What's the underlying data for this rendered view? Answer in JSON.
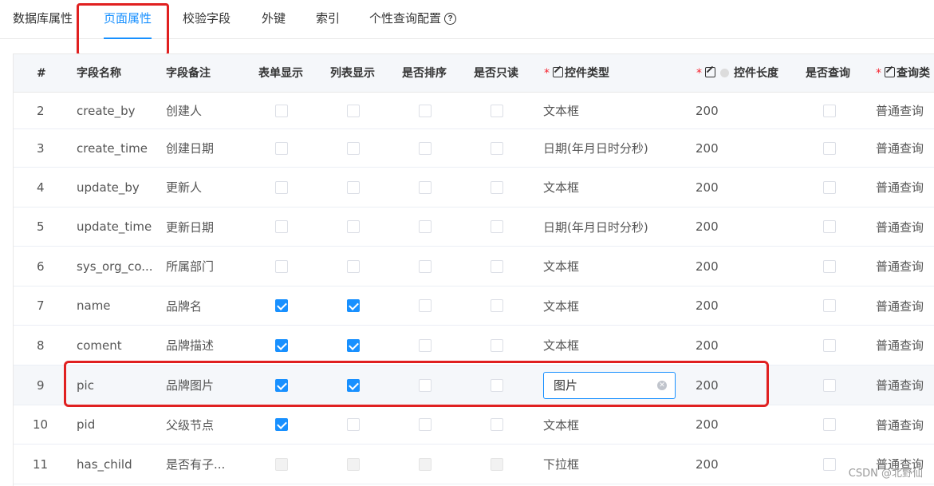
{
  "tabs": [
    {
      "label": "数据库属性"
    },
    {
      "label": "页面属性"
    },
    {
      "label": "校验字段"
    },
    {
      "label": "外键"
    },
    {
      "label": "索引"
    },
    {
      "label": "个性查询配置"
    }
  ],
  "active_tab": "页面属性",
  "header": {
    "index": "#",
    "field_name": "字段名称",
    "field_remark": "字段备注",
    "form_show": "表单显示",
    "list_show": "列表显示",
    "sortable": "是否排序",
    "readonly": "是否只读",
    "control_type": "控件类型",
    "control_length": "控件长度",
    "is_query": "是否查询",
    "query_type": "查询类"
  },
  "rows": [
    {
      "index": "2",
      "name": "create_by",
      "remark": "创建人",
      "form": false,
      "list": false,
      "sort": false,
      "readonly": false,
      "control": "文本框",
      "length": "200",
      "query": false,
      "query_type": "普通查询"
    },
    {
      "index": "3",
      "name": "create_time",
      "remark": "创建日期",
      "form": false,
      "list": false,
      "sort": false,
      "readonly": false,
      "control": "日期(年月日时分秒)",
      "length": "200",
      "query": false,
      "query_type": "普通查询"
    },
    {
      "index": "4",
      "name": "update_by",
      "remark": "更新人",
      "form": false,
      "list": false,
      "sort": false,
      "readonly": false,
      "control": "文本框",
      "length": "200",
      "query": false,
      "query_type": "普通查询"
    },
    {
      "index": "5",
      "name": "update_time",
      "remark": "更新日期",
      "form": false,
      "list": false,
      "sort": false,
      "readonly": false,
      "control": "日期(年月日时分秒)",
      "length": "200",
      "query": false,
      "query_type": "普通查询"
    },
    {
      "index": "6",
      "name": "sys_org_co...",
      "remark": "所属部门",
      "form": false,
      "list": false,
      "sort": false,
      "readonly": false,
      "control": "文本框",
      "length": "200",
      "query": false,
      "query_type": "普通查询"
    },
    {
      "index": "7",
      "name": "name",
      "remark": "品牌名",
      "form": true,
      "list": true,
      "sort": false,
      "readonly": false,
      "control": "文本框",
      "length": "200",
      "query": false,
      "query_type": "普通查询"
    },
    {
      "index": "8",
      "name": "coment",
      "remark": "品牌描述",
      "form": true,
      "list": true,
      "sort": false,
      "readonly": false,
      "control": "文本框",
      "length": "200",
      "query": false,
      "query_type": "普通查询"
    },
    {
      "index": "9",
      "name": "pic",
      "remark": "品牌图片",
      "form": true,
      "list": true,
      "sort": false,
      "readonly": false,
      "control": "图片",
      "length": "200",
      "query": false,
      "query_type": "普通查询"
    },
    {
      "index": "10",
      "name": "pid",
      "remark": "父级节点",
      "form": true,
      "list": false,
      "sort": false,
      "readonly": false,
      "control": "文本框",
      "length": "200",
      "query": false,
      "query_type": "普通查询"
    },
    {
      "index": "11",
      "name": "has_child",
      "remark": "是否有子...",
      "form": false,
      "list": false,
      "sort": false,
      "readonly": false,
      "control": "下拉框",
      "length": "200",
      "query": false,
      "query_type": "普通查询"
    }
  ],
  "editing_row_index": "9",
  "watermark": "CSDN @北野仙",
  "colors": {
    "accent": "#1890ff",
    "annotation": "#e02020",
    "required": "#f5222d"
  }
}
